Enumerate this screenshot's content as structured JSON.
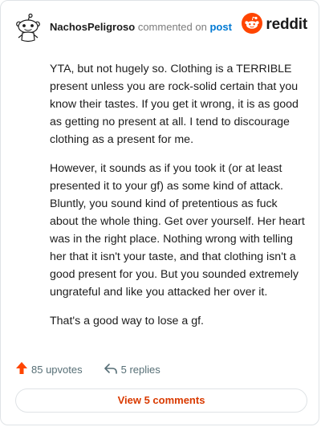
{
  "header": {
    "username": "NachosPeligroso",
    "action_text": "commented on",
    "post_link": "post",
    "brand_name": "reddit"
  },
  "comment": {
    "paragraphs": [
      "YTA, but not hugely so. Clothing is a TERRIBLE present unless you are rock-solid certain that you know their tastes. If you get it wrong, it is as good as getting no present at all. I tend to discourage clothing as a present for me.",
      "However, it sounds as if you took it (or at least presented it to your gf) as some kind of attack. Bluntly, you sound kind of pretentious as fuck about the whole thing. Get over yourself. Her heart was in the right place. Nothing wrong with telling her that it isn't your taste, and that clothing isn't a good present for you. But you sounded extremely ungrateful and like you attacked her over it.",
      "That's a good way to lose a gf."
    ]
  },
  "actions": {
    "upvotes": "85 upvotes",
    "replies": "5 replies"
  },
  "footer": {
    "view_comments": "View 5 comments"
  },
  "icons": {
    "avatar": "snoo-avatar-icon",
    "brand": "reddit-logo-icon",
    "upvote": "upvote-arrow-icon",
    "reply": "reply-arrow-icon"
  },
  "colors": {
    "brand_orange": "#ff4500",
    "link_blue": "#0079d3",
    "view_button_text": "#d93a00",
    "muted_text": "#576f76"
  }
}
